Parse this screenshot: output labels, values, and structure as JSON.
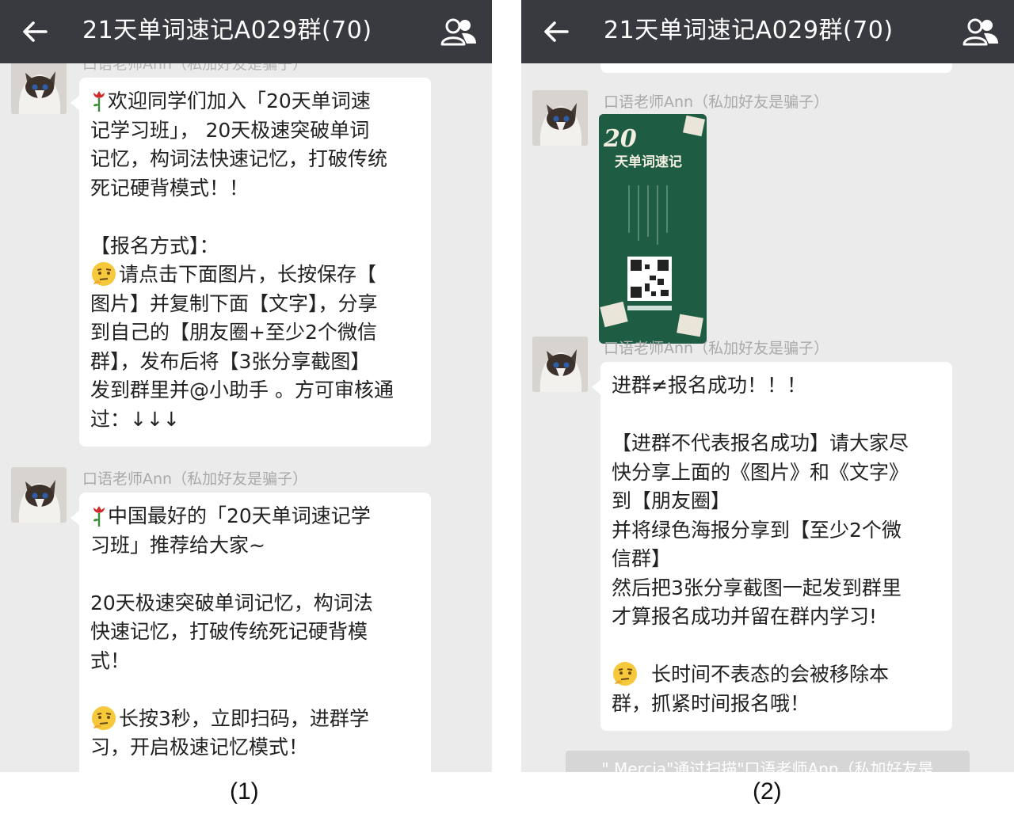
{
  "panels": [
    {
      "title": "21天单词速记A029群(70)",
      "caption": "(1)",
      "partial_sender": "口语老师Ann（私加好友是骗子）",
      "messages": [
        {
          "sender": "口语老师Ann（私加好友是骗子）",
          "lines": [
            "欢迎同学们加入「20天单词速",
            "记学习班」， 20天极速突破单词",
            "记忆，构词法快速记忆，打破传统",
            "死记硬背模式！！",
            "",
            "【报名方式】：",
            "请点击下面图片，长按保存【",
            "图片】并复制下面【文字】，分享",
            "到自己的【朋友圈+至少2个微信",
            "群】，发布后将【3张分享截图】",
            "发到群里并@小助手 。方可审核通",
            "过：↓↓↓"
          ]
        },
        {
          "sender": "口语老师Ann（私加好友是骗子）",
          "lines": [
            "中国最好的「20天单词速记学",
            "习班」推荐给大家~",
            "",
            "20天极速突破单词记忆，构词法",
            "快速记忆，打破传统死记硬背模",
            "式！",
            "",
            "长按3秒，立即扫码，进群学",
            "习，开启极速记忆模式！"
          ]
        }
      ]
    },
    {
      "title": "21天单词速记A029群(70)",
      "caption": "(2)",
      "messages": [
        {
          "sender": "口语老师Ann（私加好友是骗子）",
          "poster_title": "20",
          "poster_subtitle": "天单词速记"
        },
        {
          "sender": "口语老师Ann（私加好友是骗子）",
          "lines": [
            "进群≠报名成功！！！",
            "",
            "【进群不代表报名成功】请大家尽",
            "快分享上面的《图片》和《文字》",
            "到【朋友圈】",
            "并将绿色海报分享到【至少2个微",
            "信群】",
            "然后把3张分享截图一起发到群里",
            "才算报名成功并留在群内学习!",
            "",
            "长时间不表态的会被移除本",
            "群，抓紧时间报名哦！"
          ]
        }
      ],
      "system_notice": "\" Mercia\"通过扫描\"口语老师Ann（私加好友是"
    }
  ],
  "colors": {
    "topbar": "#393a3f",
    "chat_bg": "#ebebeb",
    "bubble": "#ffffff",
    "sender": "#a9a9a9",
    "poster": "#1f5c44"
  },
  "icons": [
    "back-arrow-icon",
    "group-members-icon",
    "rose-emoji-icon",
    "thinking-face-emoji-icon",
    "cat-avatar"
  ]
}
